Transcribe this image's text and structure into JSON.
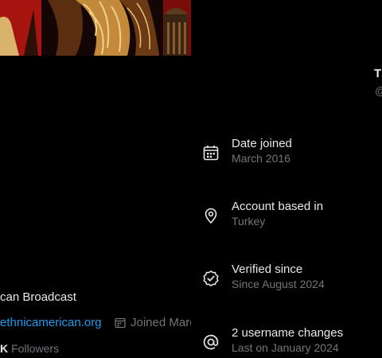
{
  "profile": {
    "bio_fragment": "can Broadcast",
    "website": "ethnicamerican.org",
    "joined_fragment": "Joined Marc",
    "followers_count_fragment": "K",
    "followers_label": "Followers"
  },
  "header": {
    "name_fragment": "Th",
    "handle_fragment": "@"
  },
  "about": {
    "items": [
      {
        "icon": "calendar-icon",
        "title": "Date joined",
        "subtitle": "March 2016"
      },
      {
        "icon": "location-pin-icon",
        "title": "Account based in",
        "subtitle": "Turkey"
      },
      {
        "icon": "verified-badge-icon",
        "title": "Verified since",
        "subtitle": "Since August 2024"
      },
      {
        "icon": "at-sign-icon",
        "title": "2 username changes",
        "subtitle": "Last on January 2024"
      }
    ]
  },
  "colors": {
    "background": "#000000",
    "text_primary": "#e7e9ea",
    "text_secondary": "#71767b",
    "link": "#1d9bf0"
  }
}
